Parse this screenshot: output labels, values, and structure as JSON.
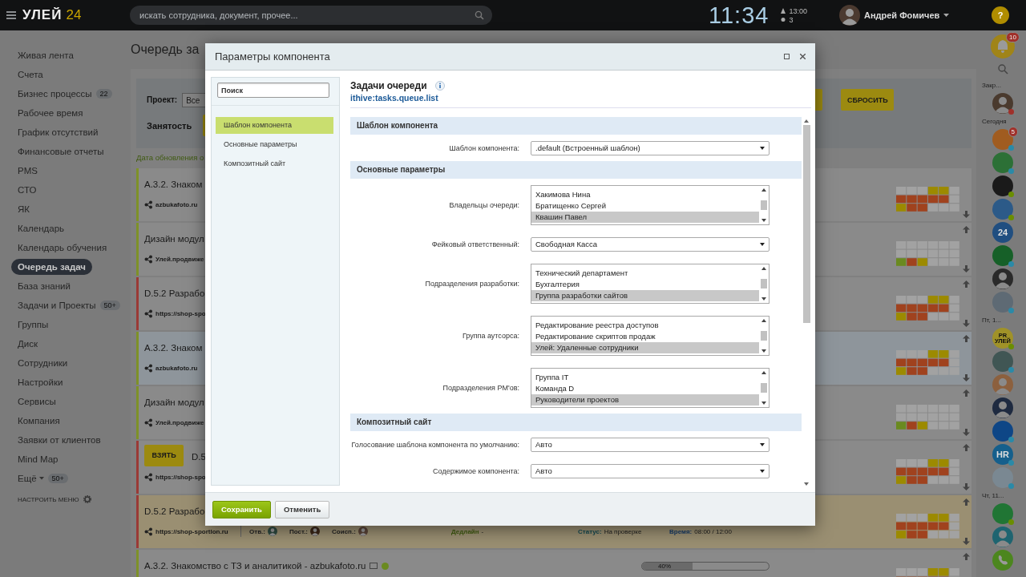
{
  "header": {
    "logo": "УЛЕЙ",
    "logo_number": "24",
    "search_placeholder": "искать сотрудника, документ, прочее...",
    "clock": "11:34",
    "next_time": "13:00",
    "count": "3",
    "user": "Андрей Фомичев",
    "help": "?"
  },
  "menu": {
    "items": [
      {
        "label": "Живая лента",
        "selected": false
      },
      {
        "label": "Счета",
        "selected": false
      },
      {
        "label": "Бизнес процессы",
        "counter": "22",
        "selected": false
      },
      {
        "label": "Рабочее время",
        "selected": false
      },
      {
        "label": "График отсутствий",
        "selected": false
      },
      {
        "label": "Финансовые отчеты",
        "selected": false
      },
      {
        "label": "PMS",
        "selected": false
      },
      {
        "label": "СТО",
        "selected": false
      },
      {
        "label": "ЯК",
        "selected": false
      },
      {
        "label": "Календарь",
        "selected": false
      },
      {
        "label": "Календарь обучения",
        "selected": false
      },
      {
        "label": "Очередь задач",
        "selected": true
      },
      {
        "label": "База знаний",
        "selected": false
      },
      {
        "label": "Задачи и Проекты",
        "counter": "50+",
        "selected": false
      },
      {
        "label": "Группы",
        "selected": false
      },
      {
        "label": "Диск",
        "selected": false
      },
      {
        "label": "Сотрудники",
        "selected": false
      },
      {
        "label": "Настройки",
        "selected": false
      },
      {
        "label": "Сервисы",
        "selected": false
      },
      {
        "label": "Компания",
        "selected": false
      },
      {
        "label": "Заявки от клиентов",
        "selected": false
      },
      {
        "label": "Mind Map",
        "selected": false
      },
      {
        "label": "Ещё",
        "counter": "50+",
        "caret": true,
        "selected": false
      }
    ],
    "settings": "НАСТРОИТЬ МЕНЮ"
  },
  "page": {
    "title": "Очередь за",
    "filter": {
      "project_label": "Проект:",
      "project_value": "Все",
      "busy_label": "Занятость",
      "reset": "СБРОСИТЬ"
    },
    "updated": "Дата обновления о",
    "cards": [
      {
        "kind": "basic",
        "title": "A.3.2. Знаком",
        "site": "azbukafoto.ru",
        "color": "#7e9128",
        "selected": false,
        "flagged": false,
        "move_up": false,
        "schedule_full": true
      },
      {
        "kind": "basic",
        "title": "Дизайн модул",
        "site": "Улей.продвиже",
        "color": "#7e9128",
        "selected": false,
        "flagged": false,
        "move_up": true,
        "schedule_full": false
      },
      {
        "kind": "basic",
        "title": "D.5.2 Разрабо",
        "site": "https://shop-spo",
        "color": "#9a3a36",
        "selected": false,
        "flagged": false,
        "move_up": true,
        "schedule_full": true
      },
      {
        "kind": "basic",
        "title": "A.3.2. Знаком",
        "site": "azbukafoto.ru",
        "color": "#7e9128",
        "selected": true,
        "flagged": false,
        "move_up": true,
        "schedule_full": true
      },
      {
        "kind": "basic",
        "title": "Дизайн модул",
        "site": "Улей.продвиже",
        "color": "#7e9128",
        "selected": false,
        "flagged": false,
        "move_up": true,
        "schedule_full": false
      },
      {
        "kind": "take",
        "take": "ВЗЯТЬ",
        "title": "D.5",
        "site": "https://shop-spo",
        "color": "#9a3a36",
        "selected": false,
        "flagged": false,
        "move_up": true,
        "schedule_full": true
      },
      {
        "kind": "detailed",
        "title": "D.5.2 Разрабо",
        "site": "https://shop-sportlon.ru",
        "color": "#9a3a36",
        "selected": false,
        "flagged": true,
        "move_up": true,
        "schedule_full": true,
        "details": {
          "owner_label": "Отв.:",
          "author_label": "Пост.:",
          "coexec_label": "Соисп.:",
          "deadline_label": "Дедлайн",
          "deadline": "-",
          "status_label": "Статус:",
          "status": "На проверке",
          "time_label": "Время:",
          "time": "08:00 / 12:00"
        }
      },
      {
        "kind": "progress",
        "title": "A.3.2. Знакомство с ТЗ и аналитикой - azbukafoto.ru",
        "color": "#7e9128",
        "selected": false,
        "flagged": false,
        "move_up": true,
        "schedule_full": true,
        "level": 0.4,
        "reading": "40%"
      }
    ]
  },
  "right_bar": {
    "items": [
      {
        "kind": "bell",
        "color": "#a08418",
        "badge": "10"
      },
      {
        "kind": "search"
      },
      {
        "kind": "label",
        "text": "Закр..."
      },
      {
        "kind": "person",
        "color": "#4a3a2e",
        "status": {
          "color": "#a0302a"
        }
      },
      {
        "kind": "label",
        "text": "Сегодня"
      },
      {
        "kind": "avatar",
        "color": "#a05c20",
        "badge": "5",
        "status": {
          "color": "#2a8aa8"
        }
      },
      {
        "kind": "avatar",
        "color": "#2c7036",
        "status": {
          "color": "#2a8aa8"
        }
      },
      {
        "kind": "avatar",
        "color": "#1a1a1a",
        "status": {
          "color": "#6a8e00"
        }
      },
      {
        "kind": "avatar",
        "color": "#2c5a88",
        "status": {
          "color": "#6a8e00"
        }
      },
      {
        "kind": "avatar",
        "color": "#204e80",
        "text": "24"
      },
      {
        "kind": "avatar",
        "color": "#166028",
        "status": {
          "color": "#2a8aa8"
        }
      },
      {
        "kind": "person",
        "color": "#2a2a2a"
      },
      {
        "kind": "avatar",
        "color": "#5e6a74",
        "status": {
          "color": "#2a8aa8"
        }
      },
      {
        "kind": "label",
        "text": "Пт, 1..."
      },
      {
        "kind": "avatar",
        "color": "#a09228",
        "text": "PR УЛЕЙ",
        "status": {
          "color": "#6a8e00"
        }
      },
      {
        "kind": "avatar",
        "color": "#405654",
        "status": {
          "color": "#2a8aa8"
        }
      },
      {
        "kind": "person",
        "color": "#8c603e"
      },
      {
        "kind": "person",
        "color": "#1e2a40"
      },
      {
        "kind": "avatar",
        "color": "#0e4686",
        "status": {
          "color": "#2a8aa8"
        }
      },
      {
        "kind": "avatar",
        "color": "#155f8c",
        "text": "HR",
        "status": {
          "color": "#2a8aa8"
        }
      },
      {
        "kind": "avatar",
        "color": "#7a8892",
        "status": {
          "color": "#2a8aa8"
        }
      },
      {
        "kind": "label",
        "text": "Чт, 11..."
      },
      {
        "kind": "avatar",
        "color": "#207534",
        "status": {
          "color": "#6a8e00"
        }
      },
      {
        "kind": "person",
        "color": "#1e6470"
      },
      {
        "kind": "phone",
        "color": "#4c861e"
      }
    ]
  },
  "dialog": {
    "title": "Параметры компонента",
    "search_placeholder": "Поиск",
    "nav": [
      {
        "label": "Шаблон компонента",
        "selected": true
      },
      {
        "label": "Основные параметры",
        "selected": false
      },
      {
        "label": "Композитный сайт",
        "selected": false
      }
    ],
    "component_title": "Задачи очереди",
    "component_id": "ithive:tasks.queue.list",
    "sections": [
      {
        "title": "Шаблон компонента",
        "rows": [
          {
            "kind": "select",
            "label": "Шаблон компонента:",
            "value": ".default (Встроенный шаблон)"
          }
        ]
      },
      {
        "title": "Основные параметры",
        "rows": [
          {
            "kind": "multiselect",
            "label": "Владельцы очереди:",
            "options": [
              {
                "label": "Хакимова Нина",
                "selected": false
              },
              {
                "label": "Братищенко Сергей",
                "selected": false
              },
              {
                "label": "Квашин Павел",
                "selected": true
              }
            ]
          },
          {
            "kind": "select",
            "label": "Фейковый ответственный:",
            "value": "Свободная Касса"
          },
          {
            "kind": "multiselect",
            "label": "Подразделения разработки:",
            "options": [
              {
                "label": "Технический департамент",
                "selected": false
              },
              {
                "label": "Бухгалтерия",
                "selected": false
              },
              {
                "label": "Группа разработки сайтов",
                "selected": true
              }
            ]
          },
          {
            "kind": "multiselect",
            "label": "Группа аутсорса:",
            "options": [
              {
                "label": "Редактирование реестра доступов",
                "selected": false
              },
              {
                "label": "Редактирование скриптов продаж",
                "selected": false
              },
              {
                "label": "Улей: Удаленные сотрудники",
                "selected": true
              }
            ]
          },
          {
            "kind": "multiselect",
            "label": "Подразделения PM'ов:",
            "options": [
              {
                "label": "Группа IT",
                "selected": false
              },
              {
                "label": "Команда D",
                "selected": false
              },
              {
                "label": "Руководители проектов",
                "selected": true
              }
            ]
          }
        ]
      },
      {
        "title": "Композитный сайт",
        "rows": [
          {
            "kind": "select",
            "label": "Голосование шаблона компонента по умолчанию:",
            "value": "Авто"
          },
          {
            "kind": "select",
            "label": "Содержимое компонента:",
            "value": "Авто"
          }
        ]
      }
    ],
    "buttons": [
      {
        "label": "Сохранить",
        "kind": "primary"
      },
      {
        "label": "Отменить",
        "kind": "secondary"
      }
    ]
  }
}
